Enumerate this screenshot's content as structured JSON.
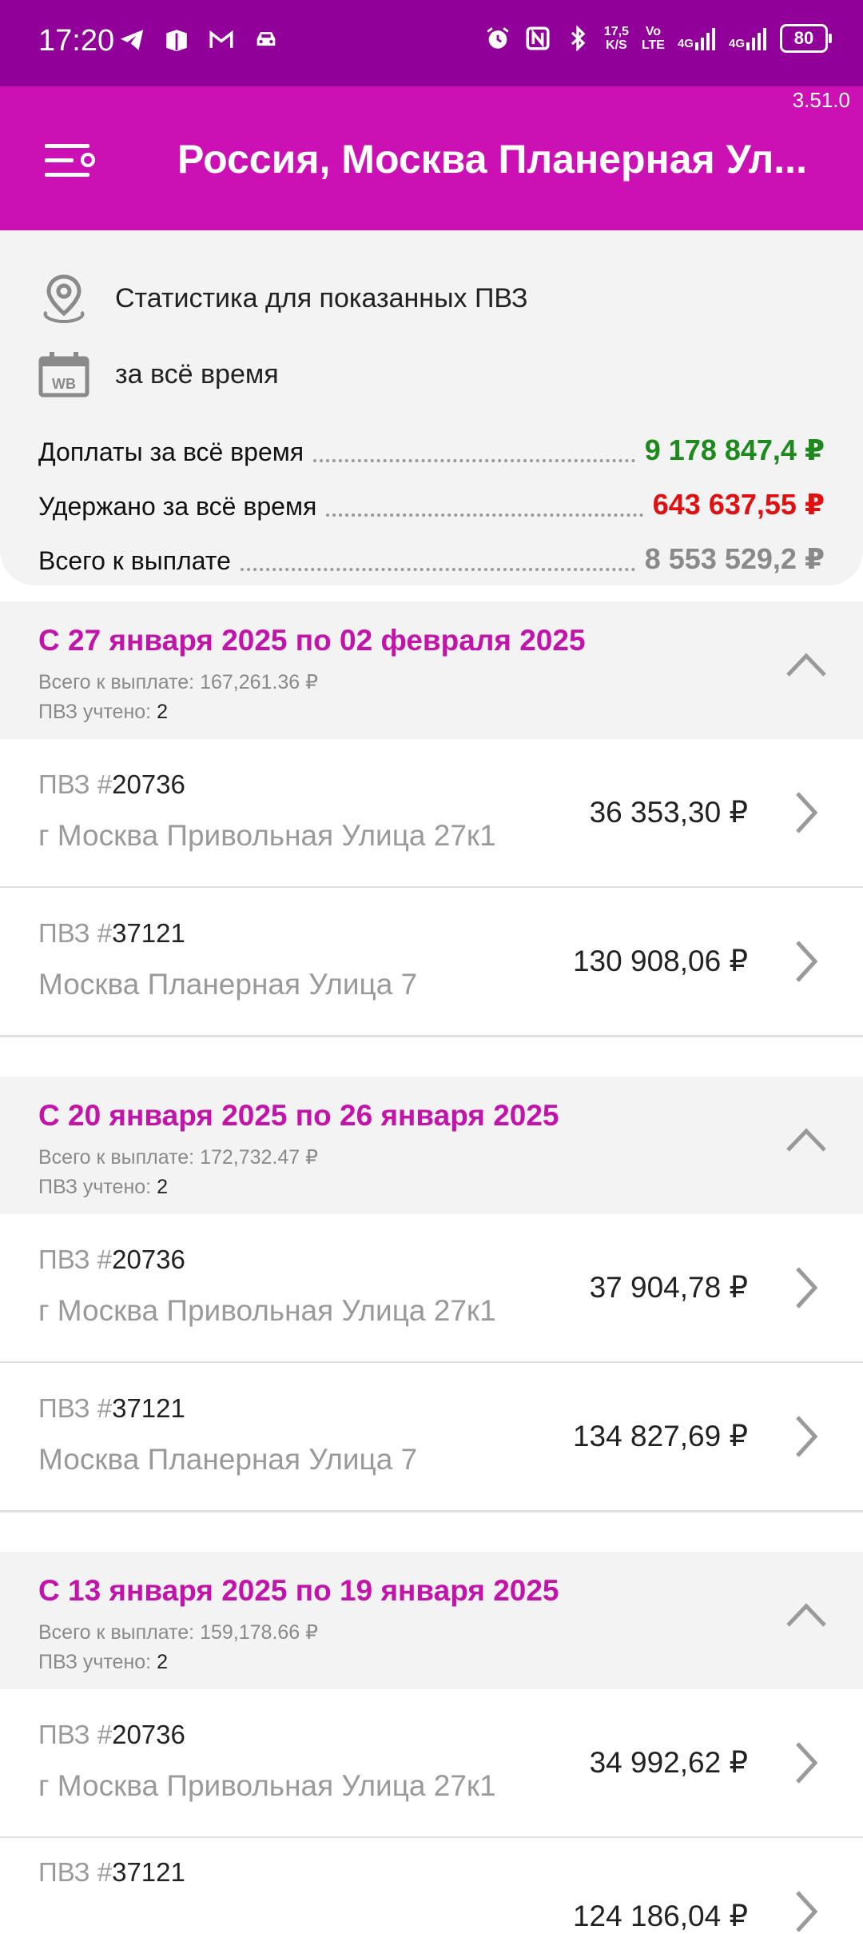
{
  "status_bar": {
    "time": "17:20",
    "net_speed_top": "17,5",
    "net_speed_bottom": "K/S",
    "volte_top": "Vo",
    "volte_bottom": "LTE",
    "net1": "4G",
    "net2": "4G",
    "battery": "80",
    "icons": [
      "telegram-icon",
      "box-icon",
      "gmail-icon",
      "car-icon",
      "alarm-icon",
      "nfc-icon",
      "bluetooth-icon",
      "signal-icon"
    ]
  },
  "app": {
    "version": "3.51.0",
    "title": "Россия, Москва Планерная Ул..."
  },
  "summary": {
    "location_text": "Статистика для показанных ПВЗ",
    "period_text": "за всё время",
    "extra_label": "Доплаты за всё время",
    "extra_value": "9 178 847,4 ₽",
    "withheld_label": "Удержано за всё время",
    "withheld_value": "643 637,55 ₽",
    "total_label": "Всего к выплате",
    "total_value": "8 553 529,2 ₽",
    "colors": {
      "extra": "#1e8a1e",
      "withheld": "#e01010",
      "total": "#8a8a8a"
    }
  },
  "weeks": [
    {
      "title": "С 27 января 2025 по 02 февраля 2025",
      "total_label": "Всего к выплате:",
      "total_value": "167,261.36 ₽",
      "count_label": "ПВЗ учтено:",
      "count_value": "2",
      "rows": [
        {
          "prefix": "ПВЗ #",
          "id": "20736",
          "address": "г Москва Привольная Улица 27к1",
          "amount": "36 353,30 ₽"
        },
        {
          "prefix": "ПВЗ #",
          "id": "37121",
          "address": "Москва Планерная Улица 7",
          "amount": "130 908,06 ₽"
        }
      ]
    },
    {
      "title": "С 20 января 2025 по 26 января 2025",
      "total_label": "Всего к выплате:",
      "total_value": "172,732.47 ₽",
      "count_label": "ПВЗ учтено:",
      "count_value": "2",
      "rows": [
        {
          "prefix": "ПВЗ #",
          "id": "20736",
          "address": "г Москва Привольная Улица 27к1",
          "amount": "37 904,78 ₽"
        },
        {
          "prefix": "ПВЗ #",
          "id": "37121",
          "address": "Москва Планерная Улица 7",
          "amount": "134 827,69 ₽"
        }
      ]
    },
    {
      "title": "С 13 января 2025 по 19 января 2025",
      "total_label": "Всего к выплате:",
      "total_value": "159,178.66 ₽",
      "count_label": "ПВЗ учтено:",
      "count_value": "2",
      "rows": [
        {
          "prefix": "ПВЗ #",
          "id": "20736",
          "address": "г Москва Привольная Улица 27к1",
          "amount": "34 992,62 ₽"
        },
        {
          "prefix": "ПВЗ #",
          "id": "37121",
          "address": "",
          "amount": "124 186,04 ₽"
        }
      ]
    }
  ]
}
